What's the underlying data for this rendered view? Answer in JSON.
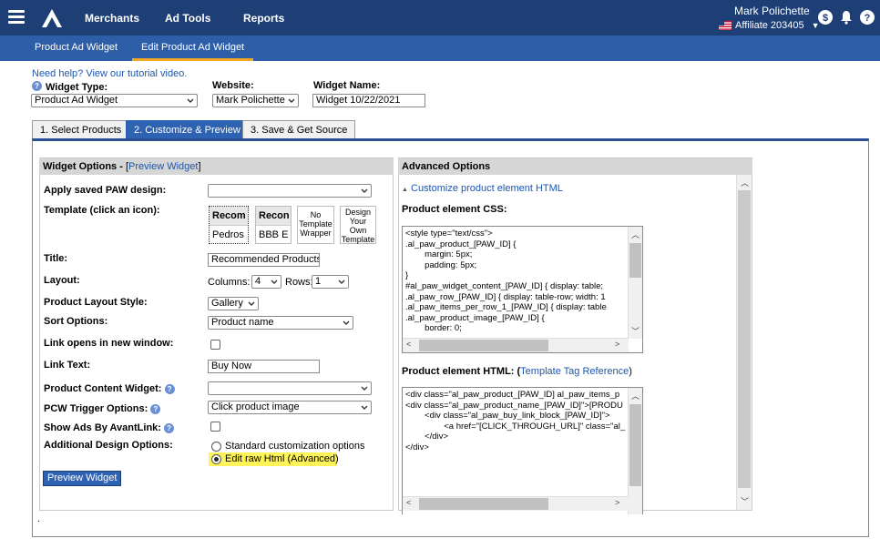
{
  "topbar": {
    "nav": [
      "Merchants",
      "Ad Tools",
      "Reports"
    ],
    "user_name": "Mark Polichette",
    "affiliate": "Affiliate 203405"
  },
  "subtabs": [
    "Product Ad Widget",
    "Edit Product Ad Widget"
  ],
  "help_link": "Need help? View our tutorial video.",
  "header": {
    "widget_type_label": "Widget Type:",
    "widget_type_value": "Product Ad Widget",
    "website_label": "Website:",
    "website_value": "Mark Polichette",
    "widget_name_label": "Widget Name:",
    "widget_name_value": "Widget 10/22/2021"
  },
  "steps": [
    "1. Select Products",
    "2. Customize & Preview",
    "3. Save & Get Source"
  ],
  "widget_options": {
    "title": "Widget Options - ",
    "preview_link_pre": "[",
    "preview_link": "Preview Widget",
    "preview_link_post": "]",
    "apply_saved_label": "Apply saved PAW design:",
    "template_label": "Template (click an icon):",
    "templates": [
      {
        "head": "Recom",
        "body": "Pedros"
      },
      {
        "head": "Recon",
        "body": "BBB E"
      }
    ],
    "template_no_wrapper": "No Template Wrapper",
    "template_design": "Design Your Own Template",
    "title_label": "Title:",
    "title_value": "Recommended Products",
    "layout_label": "Layout:",
    "columns_label": "Columns:",
    "columns_value": "4",
    "rows_label": "Rows:",
    "rows_value": "1",
    "layout_style_label": "Product Layout Style:",
    "layout_style_value": "Gallery",
    "sort_label": "Sort Options:",
    "sort_value": "Product name",
    "new_window_label": "Link opens in new window:",
    "link_text_label": "Link Text:",
    "link_text_value": "Buy Now",
    "pcw_label": "Product Content Widget:",
    "pcw_trigger_label": "PCW Trigger Options:",
    "pcw_trigger_value": "Click product image",
    "show_ads_label": "Show Ads By AvantLink:",
    "additional_label": "Additional Design Options:",
    "radio_standard": "Standard customization options",
    "radio_raw": "Edit raw Html (Advanced)",
    "preview_button": "Preview Widget"
  },
  "advanced": {
    "title": "Advanced Options",
    "customize_link": "Customize product element HTML",
    "css_label": "Product element CSS:",
    "css_code": "<style type=\"text/css\">\n.al_paw_product_[PAW_ID] {\n        margin: 5px;\n        padding: 5px;\n}\n#al_paw_widget_content_[PAW_ID] { display: table;\n.al_paw_row_[PAW_ID] { display: table-row; width: 1\n.al_paw_items_per_row_1_[PAW_ID] { display: table\n.al_paw_product_image_[PAW_ID] {\n        border: 0;",
    "html_label": "Product element HTML: (",
    "html_link": "Template Tag Reference",
    "html_label_post": ")",
    "html_code": "<div class=\"al_paw_product_[PAW_ID] al_paw_items_p\n<div class=\"al_paw_product_name_[PAW_ID]\">[PRODU\n        <div class=\"al_paw_buy_link_block_[PAW_ID]\">\n                <a href=\"[CLICK_THROUGH_URL]\" class=\"al_\n        </div>\n</div>"
  },
  "footer_dot": "."
}
